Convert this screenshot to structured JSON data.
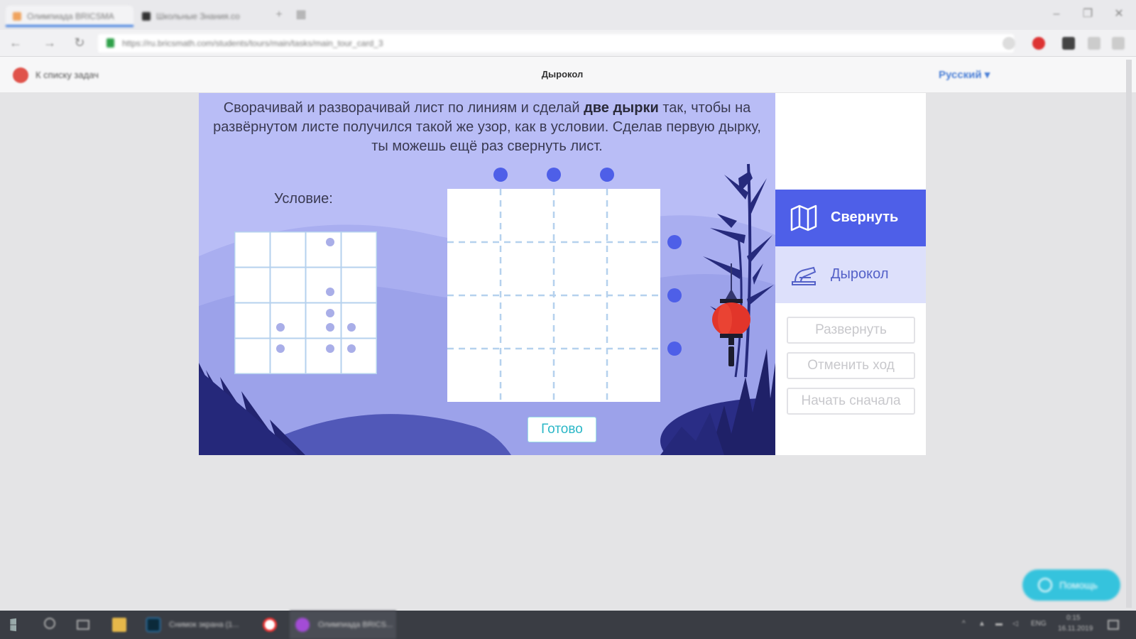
{
  "browser": {
    "tabs": [
      {
        "label": "Олимпиада BRICSMA"
      },
      {
        "label": "Школьные Знания.co"
      }
    ],
    "url": "https://ru.bricsmath.com/students/tours/main/tasks/main_tour_card_3"
  },
  "site": {
    "back_link": "К списку задач",
    "page_title": "Дырокол",
    "language": "Русский ▾"
  },
  "task": {
    "instruction_part1": "Сворачивай и разворачивай лист по линиям и сделай ",
    "instruction_bold": "две дырки",
    "instruction_part2": " так, чтобы на развёрнутом листе получился такой же узор, как в условии. Сделав первую дырку, ты можешь ещё раз свернуть лист.",
    "condition_label": "Условие:",
    "condition_grid": {
      "rows": 4,
      "cols": 4
    },
    "condition_holes": [
      {
        "col": 2.7,
        "row": 0.3
      },
      {
        "col": 2.7,
        "row": 1.7
      },
      {
        "col": 2.7,
        "row": 2.3
      },
      {
        "col": 1.3,
        "row": 2.7
      },
      {
        "col": 2.7,
        "row": 2.7
      },
      {
        "col": 3.3,
        "row": 2.7
      },
      {
        "col": 1.3,
        "row": 3.3
      },
      {
        "col": 2.7,
        "row": 3.3
      },
      {
        "col": 3.3,
        "row": 3.3
      }
    ],
    "work_grid": {
      "rows": 4,
      "cols": 4
    },
    "done_button": "Готово"
  },
  "tools": {
    "fold_label": "Свернуть",
    "punch_label": "Дырокол",
    "unfold_label": "Развернуть",
    "undo_label": "Отменить ход",
    "restart_label": "Начать сначала"
  },
  "help_button": "Помощь",
  "colors": {
    "accent": "#4e5fe8",
    "panel_bg": "#b9bdf6",
    "hole": "#a9aee8",
    "handle": "#4e5fe8",
    "grid_line": "#b5d1ee",
    "lantern": "#e2352a",
    "done_text": "#2bb7c7"
  },
  "taskbar": {
    "apps": [
      {
        "label": "Снимок экрана (1..."
      },
      {
        "label": "Олимпиада BRICS..."
      }
    ],
    "tray_lang": "ENG",
    "tray_time": "0:15",
    "tray_date": "16.11.2019"
  }
}
